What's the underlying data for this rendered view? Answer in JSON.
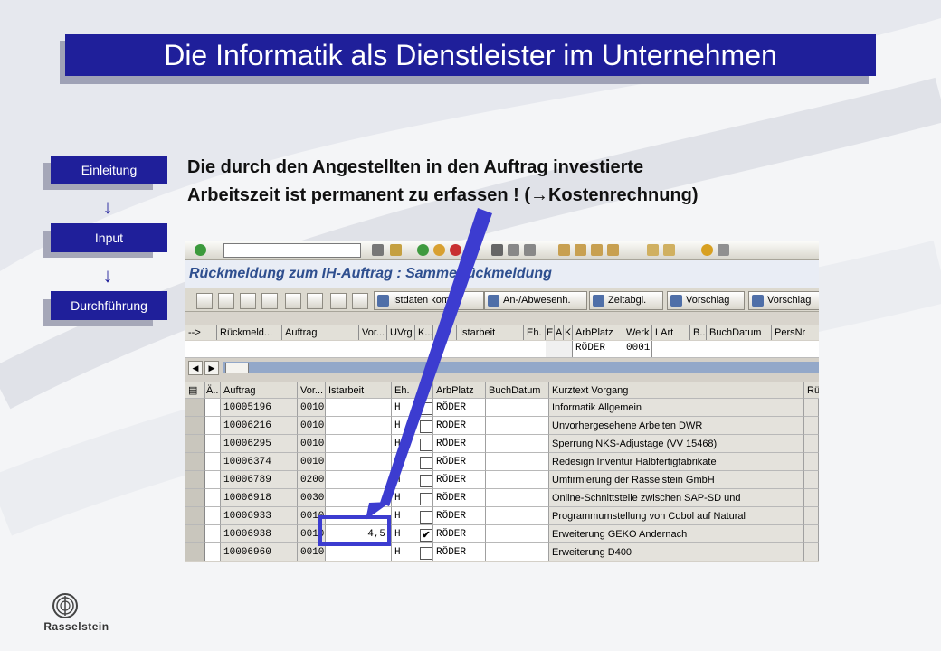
{
  "slide": {
    "title": "Die Informatik als Dienstleister im Unternehmen",
    "headline_line1": "Die durch den Angestellten in den Auftrag investierte",
    "headline_line2": "Arbeitszeit ist permanent zu erfassen ! (→Kostenrechnung)",
    "nav": [
      {
        "label": "Einleitung"
      },
      {
        "label": "Input"
      },
      {
        "label": "Durchführung"
      }
    ],
    "logo_text": "Rasselstein"
  },
  "sap": {
    "window_title": "Rückmeldung zum IH-Auftrag : Sammelrückmeldung",
    "toolbar_buttons": [
      {
        "label": "Istdaten kompl."
      },
      {
        "label": "An-/Abwesenh."
      },
      {
        "label": "Zeitabgl."
      },
      {
        "label": "Vorschlag"
      },
      {
        "label": "Vorschlag"
      }
    ],
    "header_columns": [
      "-->",
      "Rückmeld...",
      "Auftrag",
      "Vor...",
      "UVrg",
      "K...",
      "...",
      "Istarbeit",
      "Eh.",
      "E",
      "A",
      "K",
      "ArbPlatz",
      "Werk",
      "LArt",
      "B..",
      "BuchDatum",
      "PersNr"
    ],
    "header_row": {
      "arbplatz": "RÖDER",
      "werk": "0001"
    },
    "grid_columns": [
      "Ä..",
      "Auftrag",
      "Vor...",
      "Istarbeit",
      "Eh.",
      "...",
      "ArbPlatz",
      "BuchDatum",
      "Kurztext Vorgang",
      "Rü"
    ],
    "rows": [
      {
        "auftrag": "10005196",
        "vor": "0010",
        "istarbeit": "",
        "eh": "H",
        "checked": "",
        "arbplatz": "RÖDER",
        "buchdatum": "",
        "kurztext": "Informatik Allgemein"
      },
      {
        "auftrag": "10006216",
        "vor": "0010",
        "istarbeit": "",
        "eh": "H",
        "checked": "",
        "arbplatz": "RÖDER",
        "buchdatum": "",
        "kurztext": "Unvorhergesehene Arbeiten DWR"
      },
      {
        "auftrag": "10006295",
        "vor": "0010",
        "istarbeit": "",
        "eh": "H",
        "checked": "",
        "arbplatz": "RÖDER",
        "buchdatum": "",
        "kurztext": "Sperrung NKS-Adjustage (VV 15468)"
      },
      {
        "auftrag": "10006374",
        "vor": "0010",
        "istarbeit": "",
        "eh": "H",
        "checked": "",
        "arbplatz": "RÖDER",
        "buchdatum": "",
        "kurztext": "Redesign Inventur Halbfertigfabrikate"
      },
      {
        "auftrag": "10006789",
        "vor": "0200",
        "istarbeit": "",
        "eh": "H",
        "checked": "",
        "arbplatz": "RÖDER",
        "buchdatum": "",
        "kurztext": "Umfirmierung der Rasselstein GmbH"
      },
      {
        "auftrag": "10006918",
        "vor": "0030",
        "istarbeit": "",
        "eh": "H",
        "checked": "",
        "arbplatz": "RÖDER",
        "buchdatum": "",
        "kurztext": "Online-Schnittstelle zwischen SAP-SD und"
      },
      {
        "auftrag": "10006933",
        "vor": "0010",
        "istarbeit": "",
        "eh": "H",
        "checked": "",
        "arbplatz": "RÖDER",
        "buchdatum": "",
        "kurztext": "Programmumstellung von Cobol auf Natural"
      },
      {
        "auftrag": "10006938",
        "vor": "0010",
        "istarbeit": "4,5",
        "eh": "H",
        "checked": "✔",
        "arbplatz": "RÖDER",
        "buchdatum": "",
        "kurztext": "Erweiterung GEKO Andernach"
      },
      {
        "auftrag": "10006960",
        "vor": "0010",
        "istarbeit": "",
        "eh": "H",
        "checked": "",
        "arbplatz": "RÖDER",
        "buchdatum": "",
        "kurztext": "Erweiterung D400"
      }
    ]
  },
  "colors": {
    "navy": "#1f1f9a",
    "arrow": "#3c3cd0",
    "sap_title": "#2f4f8f"
  }
}
